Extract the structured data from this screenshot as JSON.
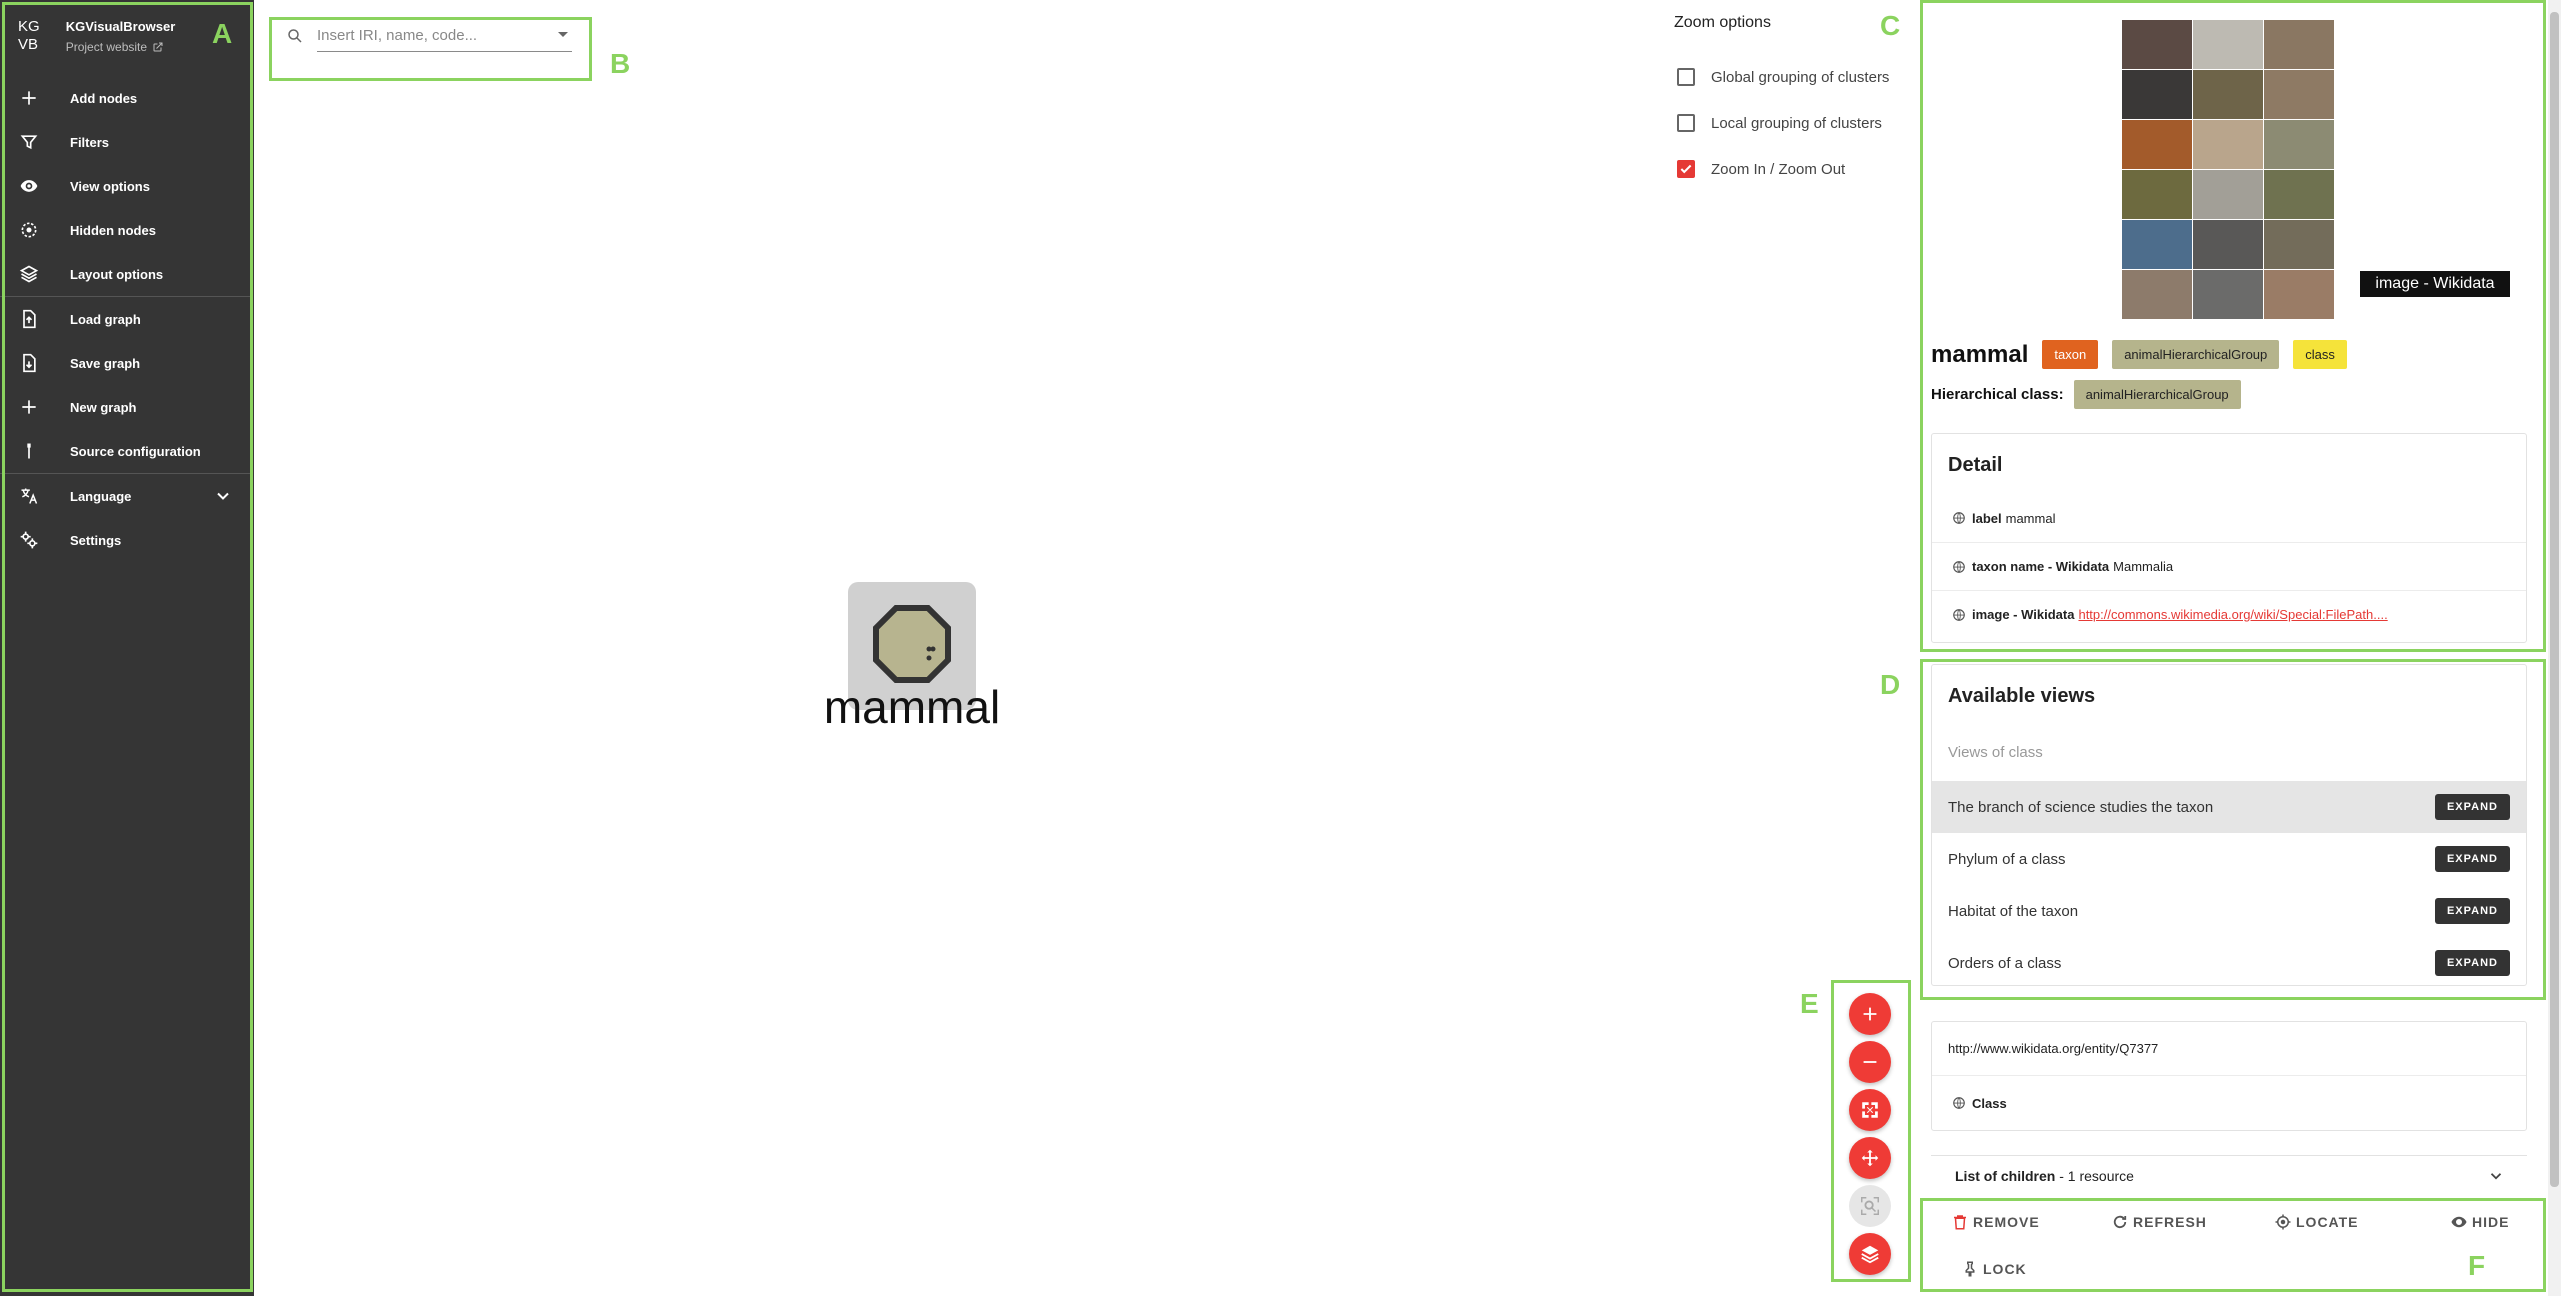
{
  "brand": {
    "logo_line1": "KG",
    "logo_line2": "VB",
    "name": "KGVisualBrowser",
    "project_link": "Project website"
  },
  "sidebar": {
    "items": [
      {
        "label": "Add nodes",
        "icon": "plus-icon"
      },
      {
        "label": "Filters",
        "icon": "filter-icon"
      },
      {
        "label": "View options",
        "icon": "eye-icon"
      },
      {
        "label": "Hidden nodes",
        "icon": "hidden-nodes-icon"
      },
      {
        "label": "Layout options",
        "icon": "layers-icon"
      },
      {
        "label": "Load graph",
        "icon": "file-upload-icon"
      },
      {
        "label": "Save graph",
        "icon": "file-save-icon"
      },
      {
        "label": "New graph",
        "icon": "plus-icon"
      },
      {
        "label": "Source configuration",
        "icon": "plug-icon"
      },
      {
        "label": "Language",
        "icon": "translate-icon"
      },
      {
        "label": "Settings",
        "icon": "settings-icon"
      }
    ]
  },
  "search": {
    "placeholder": "Insert IRI, name, code..."
  },
  "zoom_options": {
    "title": "Zoom options",
    "global_grouping": {
      "label": "Global grouping of clusters",
      "checked": false
    },
    "local_grouping": {
      "label": "Local grouping of clusters",
      "checked": false
    },
    "zoom_in_out": {
      "label": "Zoom In / Zoom Out",
      "checked": true
    }
  },
  "graph": {
    "node_label": "mammal"
  },
  "annotations": {
    "a": "A",
    "b": "B",
    "c": "C",
    "d": "D",
    "e": "E",
    "f": "F"
  },
  "entity": {
    "image_tag": "image - Wikidata",
    "title": "mammal",
    "chips": [
      {
        "label": "taxon",
        "bg": "#e0631f",
        "fg": "#ffffff"
      },
      {
        "label": "animalHierarchicalGroup",
        "bg": "#b5b48c",
        "fg": "#222222"
      },
      {
        "label": "class",
        "bg": "#f5e33a",
        "fg": "#222222"
      }
    ],
    "hierarchical_label": "Hierarchical class:",
    "hierarchical_chip": "animalHierarchicalGroup"
  },
  "detail": {
    "title": "Detail",
    "rows": [
      {
        "key": "label",
        "value": "mammal"
      },
      {
        "key": "taxon name - Wikidata",
        "value": "Mammalia"
      },
      {
        "key": "image - Wikidata",
        "value": "http://commons.wikimedia.org/wiki/Special:FilePath...."
      }
    ]
  },
  "views": {
    "title": "Available views",
    "subtitle": "Views of class",
    "expand_label": "EXPAND",
    "items": [
      "The branch of science studies the taxon",
      "Phylum of a class",
      "Habitat of the taxon",
      "Orders of a class"
    ]
  },
  "uri": {
    "iri": "http://www.wikidata.org/entity/Q7377",
    "type": "Class"
  },
  "children": {
    "label": "List of children",
    "count": " - 1 resource"
  },
  "actions": {
    "remove": "REMOVE",
    "refresh": "REFRESH",
    "locate": "LOCATE",
    "hide": "HIDE",
    "lock": "LOCK"
  },
  "colors": {
    "accent": "#ef3b36",
    "sidebar_bg": "#353535",
    "annotation": "#8bd35f"
  }
}
